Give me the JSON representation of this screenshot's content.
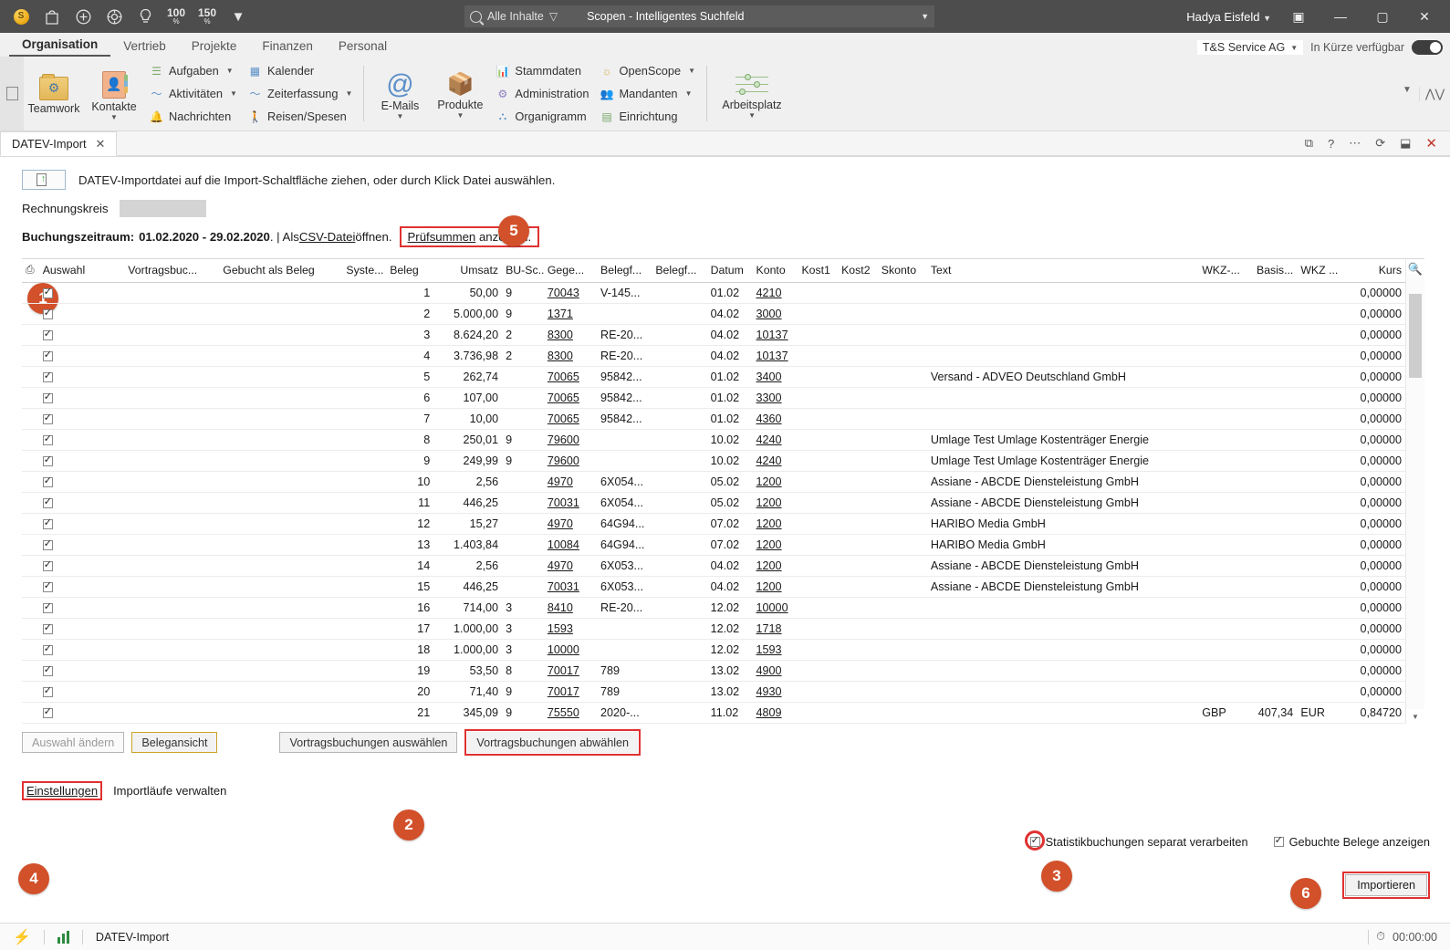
{
  "titlebar": {
    "icons": [
      {
        "name": "coin-icon",
        "glyph": "S"
      },
      {
        "name": "bag-icon",
        "glyph": "⌂"
      },
      {
        "name": "plus-circle-icon",
        "glyph": "+"
      },
      {
        "name": "target-icon",
        "glyph": "◎"
      },
      {
        "name": "bulb-icon",
        "glyph": "♀"
      }
    ],
    "zoom_100": "100",
    "zoom_100_unit": "%",
    "zoom_150": "150",
    "zoom_150_unit": "%",
    "overflow_caret": "▼",
    "search": {
      "filter": "Alle Inhalte",
      "placeholder": "Scopen - Intelligentes Suchfeld",
      "dropdown_caret": "▼"
    },
    "user": "Hadya Eisfeld",
    "user_caret": "▼",
    "pin_icon": "▣",
    "minimize": "—",
    "maximize": "▢",
    "close": "✕"
  },
  "menubar": {
    "tabs": [
      {
        "label": "Organisation",
        "active": true
      },
      {
        "label": "Vertrieb",
        "active": false
      },
      {
        "label": "Projekte",
        "active": false
      },
      {
        "label": "Finanzen",
        "active": false
      },
      {
        "label": "Personal",
        "active": false
      }
    ],
    "company": "T&S Service AG",
    "company_caret": "▼",
    "availability_label": "In Kürze verfügbar",
    "availability_on": true
  },
  "ribbon": {
    "big_buttons": [
      {
        "label": "Teamwork",
        "caret": ""
      },
      {
        "label": "Kontakte",
        "caret": "▼"
      }
    ],
    "group1": [
      {
        "label": "Aufgaben",
        "caret": "▼",
        "icon": "list-icon"
      },
      {
        "label": "Aktivitäten",
        "caret": "▼",
        "icon": "pulse-icon"
      },
      {
        "label": "Nachrichten",
        "caret": "",
        "icon": "bell-icon"
      }
    ],
    "group2": [
      {
        "label": "Kalender",
        "caret": "",
        "icon": "calendar-icon"
      },
      {
        "label": "Zeiterfassung",
        "caret": "▼",
        "icon": "pulse-icon"
      },
      {
        "label": "Reisen/Spesen",
        "caret": "",
        "icon": "traveler-icon"
      }
    ],
    "big_buttons2": [
      {
        "label": "E-Mails",
        "caret": "▼"
      },
      {
        "label": "Produkte",
        "caret": "▼"
      }
    ],
    "group3": [
      {
        "label": "Stammdaten",
        "caret": "",
        "icon": "chart-icon"
      },
      {
        "label": "Administration",
        "caret": "",
        "icon": "admin-icon"
      },
      {
        "label": "Organigramm",
        "caret": "",
        "icon": "orgchart-icon"
      }
    ],
    "group4": [
      {
        "label": "OpenScope",
        "caret": "▼",
        "icon": "openscope-icon"
      },
      {
        "label": "Mandanten",
        "caret": "▼",
        "icon": "clients-icon"
      },
      {
        "label": "Einrichtung",
        "caret": "",
        "icon": "setup-icon"
      }
    ],
    "workspace": {
      "label": "Arbeitsplatz",
      "caret": "▼"
    }
  },
  "tabstrip": {
    "tab_label": "DATEV-Import",
    "tab_close": "✕",
    "tools": [
      "⧉",
      "?",
      "⋯",
      "⟳",
      "⬓"
    ],
    "close": "✕"
  },
  "page": {
    "drop_hint": "DATEV-Importdatei auf die Import-Schaltfläche ziehen, oder durch Klick Datei auswählen.",
    "rechnungskreis_label": "Rechnungskreis",
    "rechnungskreis_value": "",
    "period_label": "Buchungszeitraum:",
    "period_value": "01.02.2020 - 29.02.2020",
    "period_sep": ". | Als ",
    "csv_link": "CSV-Datei",
    "csv_tail": " öffnen. ",
    "pruefsummen_link": "Prüfsummen",
    "pruefsummen_tail": " anzeigen."
  },
  "callouts": [
    {
      "number": "1"
    },
    {
      "number": "2"
    },
    {
      "number": "3"
    },
    {
      "number": "4"
    },
    {
      "number": "5"
    },
    {
      "number": "6"
    }
  ],
  "table": {
    "columns": [
      "Auswahl",
      "Vortragsbuc...",
      "Gebucht als Beleg",
      "Syste...",
      "Beleg",
      "Umsatz",
      "BU-Sc...",
      "Gege...",
      "Belegf...",
      "Belegf...",
      "Datum",
      "Konto",
      "Kost1",
      "Kost2",
      "Skonto",
      "Text",
      "WKZ-...",
      "Basis...",
      "WKZ ...",
      "Kurs"
    ],
    "rows": [
      {
        "sel": true,
        "vortrag": "",
        "gebucht": "",
        "system": "",
        "beleg": "1",
        "umsatz": "50,00",
        "bu": "9",
        "gegen": "70043",
        "bf1": "V-145...",
        "bf2": "",
        "datum": "01.02",
        "konto": "4210",
        "kost1": "",
        "kost2": "",
        "skonto": "",
        "text": "",
        "wkz1": "",
        "basis": "",
        "wkz2": "",
        "kurs": "0,00000"
      },
      {
        "sel": true,
        "vortrag": "",
        "gebucht": "",
        "system": "",
        "beleg": "2",
        "umsatz": "5.000,00",
        "bu": "9",
        "gegen": "1371",
        "bf1": "",
        "bf2": "",
        "datum": "04.02",
        "konto": "3000",
        "kost1": "",
        "kost2": "",
        "skonto": "",
        "text": "",
        "wkz1": "",
        "basis": "",
        "wkz2": "",
        "kurs": "0,00000"
      },
      {
        "sel": true,
        "vortrag": "",
        "gebucht": "",
        "system": "",
        "beleg": "3",
        "umsatz": "8.624,20",
        "bu": "2",
        "gegen": "8300",
        "bf1": "RE-20...",
        "bf2": "",
        "datum": "04.02",
        "konto": "10137",
        "kost1": "",
        "kost2": "",
        "skonto": "",
        "text": "",
        "wkz1": "",
        "basis": "",
        "wkz2": "",
        "kurs": "0,00000"
      },
      {
        "sel": true,
        "vortrag": "",
        "gebucht": "",
        "system": "",
        "beleg": "4",
        "umsatz": "3.736,98",
        "bu": "2",
        "gegen": "8300",
        "bf1": "RE-20...",
        "bf2": "",
        "datum": "04.02",
        "konto": "10137",
        "kost1": "",
        "kost2": "",
        "skonto": "",
        "text": "",
        "wkz1": "",
        "basis": "",
        "wkz2": "",
        "kurs": "0,00000"
      },
      {
        "sel": true,
        "vortrag": "",
        "gebucht": "",
        "system": "",
        "beleg": "5",
        "umsatz": "262,74",
        "bu": "",
        "gegen": "70065",
        "bf1": "95842...",
        "bf2": "",
        "datum": "01.02",
        "konto": "3400",
        "kost1": "",
        "kost2": "",
        "skonto": "",
        "text": "Versand - ADVEO Deutschland GmbH",
        "wkz1": "",
        "basis": "",
        "wkz2": "",
        "kurs": "0,00000"
      },
      {
        "sel": true,
        "vortrag": "",
        "gebucht": "",
        "system": "",
        "beleg": "6",
        "umsatz": "107,00",
        "bu": "",
        "gegen": "70065",
        "bf1": "95842...",
        "bf2": "",
        "datum": "01.02",
        "konto": "3300",
        "kost1": "",
        "kost2": "",
        "skonto": "",
        "text": "",
        "wkz1": "",
        "basis": "",
        "wkz2": "",
        "kurs": "0,00000"
      },
      {
        "sel": true,
        "vortrag": "",
        "gebucht": "",
        "system": "",
        "beleg": "7",
        "umsatz": "10,00",
        "bu": "",
        "gegen": "70065",
        "bf1": "95842...",
        "bf2": "",
        "datum": "01.02",
        "konto": "4360",
        "kost1": "",
        "kost2": "",
        "skonto": "",
        "text": "",
        "wkz1": "",
        "basis": "",
        "wkz2": "",
        "kurs": "0,00000"
      },
      {
        "sel": true,
        "vortrag": "",
        "gebucht": "",
        "system": "",
        "beleg": "8",
        "umsatz": "250,01",
        "bu": "9",
        "gegen": "79600",
        "bf1": "",
        "bf2": "",
        "datum": "10.02",
        "konto": "4240",
        "kost1": "",
        "kost2": "",
        "skonto": "",
        "text": "Umlage Test Umlage Kostenträger Energie",
        "wkz1": "",
        "basis": "",
        "wkz2": "",
        "kurs": "0,00000"
      },
      {
        "sel": true,
        "vortrag": "",
        "gebucht": "",
        "system": "",
        "beleg": "9",
        "umsatz": "249,99",
        "bu": "9",
        "gegen": "79600",
        "bf1": "",
        "bf2": "",
        "datum": "10.02",
        "konto": "4240",
        "kost1": "",
        "kost2": "",
        "skonto": "",
        "text": "Umlage Test Umlage Kostenträger Energie",
        "wkz1": "",
        "basis": "",
        "wkz2": "",
        "kurs": "0,00000"
      },
      {
        "sel": true,
        "vortrag": "",
        "gebucht": "",
        "system": "",
        "beleg": "10",
        "umsatz": "2,56",
        "bu": "",
        "gegen": "4970",
        "bf1": "6X054...",
        "bf2": "",
        "datum": "05.02",
        "konto": "1200",
        "kost1": "",
        "kost2": "",
        "skonto": "",
        "text": "Assiane - ABCDE Diensteleistung GmbH",
        "wkz1": "",
        "basis": "",
        "wkz2": "",
        "kurs": "0,00000"
      },
      {
        "sel": true,
        "vortrag": "",
        "gebucht": "",
        "system": "",
        "beleg": "11",
        "umsatz": "446,25",
        "bu": "",
        "gegen": "70031",
        "bf1": "6X054...",
        "bf2": "",
        "datum": "05.02",
        "konto": "1200",
        "kost1": "",
        "kost2": "",
        "skonto": "",
        "text": "Assiane - ABCDE Diensteleistung GmbH",
        "wkz1": "",
        "basis": "",
        "wkz2": "",
        "kurs": "0,00000"
      },
      {
        "sel": true,
        "vortrag": "",
        "gebucht": "",
        "system": "",
        "beleg": "12",
        "umsatz": "15,27",
        "bu": "",
        "gegen": "4970",
        "bf1": "64G94...",
        "bf2": "",
        "datum": "07.02",
        "konto": "1200",
        "kost1": "",
        "kost2": "",
        "skonto": "",
        "text": "HARIBO Media GmbH",
        "wkz1": "",
        "basis": "",
        "wkz2": "",
        "kurs": "0,00000"
      },
      {
        "sel": true,
        "vortrag": "",
        "gebucht": "",
        "system": "",
        "beleg": "13",
        "umsatz": "1.403,84",
        "bu": "",
        "gegen": "10084",
        "bf1": "64G94...",
        "bf2": "",
        "datum": "07.02",
        "konto": "1200",
        "kost1": "",
        "kost2": "",
        "skonto": "",
        "text": "HARIBO Media GmbH",
        "wkz1": "",
        "basis": "",
        "wkz2": "",
        "kurs": "0,00000"
      },
      {
        "sel": true,
        "vortrag": "",
        "gebucht": "",
        "system": "",
        "beleg": "14",
        "umsatz": "2,56",
        "bu": "",
        "gegen": "4970",
        "bf1": "6X053...",
        "bf2": "",
        "datum": "04.02",
        "konto": "1200",
        "kost1": "",
        "kost2": "",
        "skonto": "",
        "text": "Assiane - ABCDE Diensteleistung GmbH",
        "wkz1": "",
        "basis": "",
        "wkz2": "",
        "kurs": "0,00000"
      },
      {
        "sel": true,
        "vortrag": "",
        "gebucht": "",
        "system": "",
        "beleg": "15",
        "umsatz": "446,25",
        "bu": "",
        "gegen": "70031",
        "bf1": "6X053...",
        "bf2": "",
        "datum": "04.02",
        "konto": "1200",
        "kost1": "",
        "kost2": "",
        "skonto": "",
        "text": "Assiane - ABCDE Diensteleistung GmbH",
        "wkz1": "",
        "basis": "",
        "wkz2": "",
        "kurs": "0,00000"
      },
      {
        "sel": true,
        "vortrag": "",
        "gebucht": "",
        "system": "",
        "beleg": "16",
        "umsatz": "714,00",
        "bu": "3",
        "gegen": "8410",
        "bf1": "RE-20...",
        "bf2": "",
        "datum": "12.02",
        "konto": "10000",
        "kost1": "",
        "kost2": "",
        "skonto": "",
        "text": "",
        "wkz1": "",
        "basis": "",
        "wkz2": "",
        "kurs": "0,00000"
      },
      {
        "sel": true,
        "vortrag": "",
        "gebucht": "",
        "system": "",
        "beleg": "17",
        "umsatz": "1.000,00",
        "bu": "3",
        "gegen": "1593",
        "bf1": "",
        "bf2": "",
        "datum": "12.02",
        "konto": "1718",
        "kost1": "",
        "kost2": "",
        "skonto": "",
        "text": "",
        "wkz1": "",
        "basis": "",
        "wkz2": "",
        "kurs": "0,00000"
      },
      {
        "sel": true,
        "vortrag": "",
        "gebucht": "",
        "system": "",
        "beleg": "18",
        "umsatz": "1.000,00",
        "bu": "3",
        "gegen": "10000",
        "bf1": "",
        "bf2": "",
        "datum": "12.02",
        "konto": "1593",
        "kost1": "",
        "kost2": "",
        "skonto": "",
        "text": "",
        "wkz1": "",
        "basis": "",
        "wkz2": "",
        "kurs": "0,00000"
      },
      {
        "sel": true,
        "vortrag": "",
        "gebucht": "",
        "system": "",
        "beleg": "19",
        "umsatz": "53,50",
        "bu": "8",
        "gegen": "70017",
        "bf1": "789",
        "bf2": "",
        "datum": "13.02",
        "konto": "4900",
        "kost1": "",
        "kost2": "",
        "skonto": "",
        "text": "",
        "wkz1": "",
        "basis": "",
        "wkz2": "",
        "kurs": "0,00000"
      },
      {
        "sel": true,
        "vortrag": "",
        "gebucht": "",
        "system": "",
        "beleg": "20",
        "umsatz": "71,40",
        "bu": "9",
        "gegen": "70017",
        "bf1": "789",
        "bf2": "",
        "datum": "13.02",
        "konto": "4930",
        "kost1": "",
        "kost2": "",
        "skonto": "",
        "text": "",
        "wkz1": "",
        "basis": "",
        "wkz2": "",
        "kurs": "0,00000"
      },
      {
        "sel": true,
        "vortrag": "",
        "gebucht": "",
        "system": "",
        "beleg": "21",
        "umsatz": "345,09",
        "bu": "9",
        "gegen": "75550",
        "bf1": "2020-...",
        "bf2": "",
        "datum": "11.02",
        "konto": "4809",
        "kost1": "",
        "kost2": "",
        "skonto": "",
        "text": "",
        "wkz1": "GBP",
        "basis": "407,34",
        "wkz2": "EUR",
        "kurs": "0,84720"
      }
    ]
  },
  "buttons": {
    "auswahl_aendern": "Auswahl ändern",
    "belegansicht": "Belegansicht",
    "vortrag_auswaehlen": "Vortragsbuchungen auswählen",
    "vortrag_abwaehlen": "Vortragsbuchungen abwählen",
    "einstellungen": "Einstellungen",
    "importlaeufe": "Importläufe verwalten",
    "importieren": "Importieren"
  },
  "options": {
    "statistik": {
      "label": "Statistikbuchungen separat verarbeiten",
      "checked": true
    },
    "gebuchte": {
      "label": "Gebuchte Belege anzeigen",
      "checked": true
    }
  },
  "statusbar": {
    "doc_label": "DATEV-Import",
    "timer": "00:00:00",
    "lightning_icon": "⚡",
    "bars_icon": "bar-chart-icon",
    "clock_icon": "⏱"
  }
}
